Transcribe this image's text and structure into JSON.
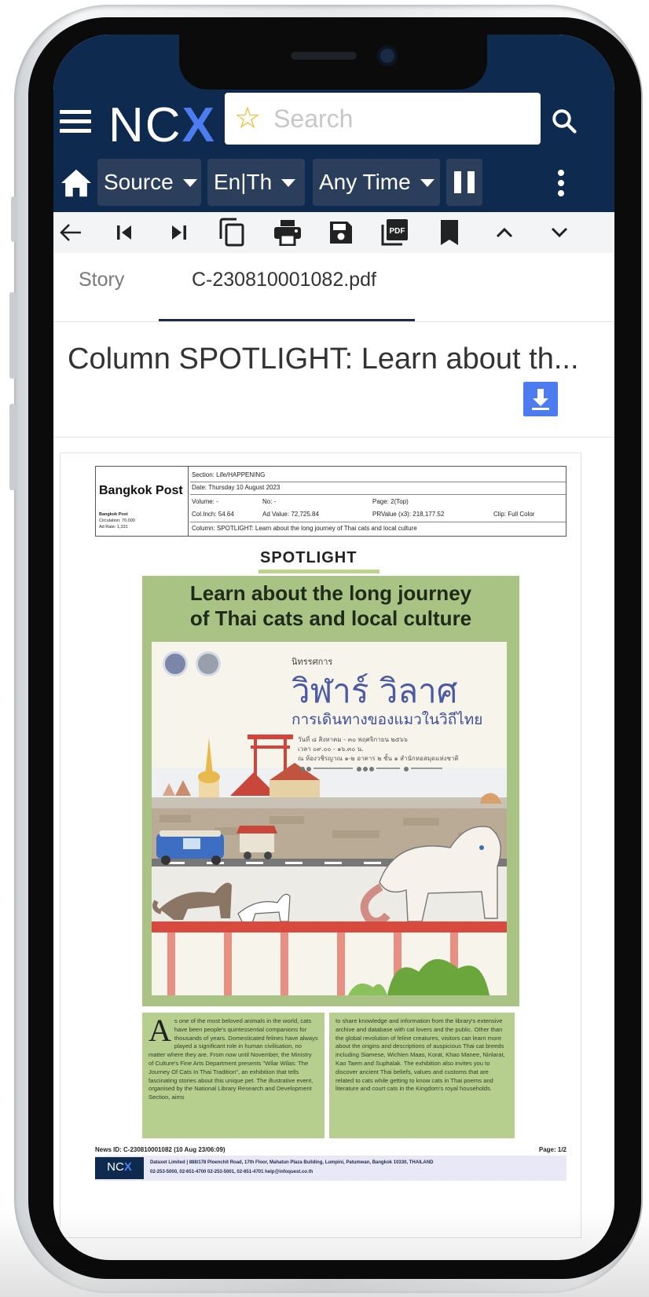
{
  "app": {
    "logo_prefix": "NC",
    "logo_accent": "X",
    "search_placeholder": "Search",
    "colors": {
      "header_bg": "#0f2a4f",
      "chip_bg": "#2b3f5c",
      "accent": "#4d7cf0",
      "star": "#f2b51c"
    }
  },
  "filters": {
    "source_label": "Source",
    "language_label": "En|Th",
    "time_label": "Any Time"
  },
  "toolbar": {
    "icons": [
      "back-arrow-icon",
      "first-page-icon",
      "last-page-icon",
      "copy-icon",
      "print-icon",
      "save-icon",
      "pdf-icon",
      "bookmark-icon",
      "chevron-up-icon",
      "chevron-down-icon"
    ],
    "pdf_badge": "PDF"
  },
  "tabs": {
    "story_label": "Story",
    "pdf_label": "C-230810001082.pdf"
  },
  "article": {
    "title": "Column SPOTLIGHT: Learn about th..."
  },
  "clipping": {
    "publication": "Bangkok Post",
    "pub_small": "Bangkok Post",
    "circulation": "Circulation: 70,000",
    "ad_rate": "Ad Rate: 1,331",
    "section": "Section: Life/HAPPENING",
    "date": "Date: Thursday 10 August 2023",
    "volume": "Volume: -",
    "no": "No: -",
    "page": "Page: 2(Top)",
    "col_inch": "Col.Inch: 54.64",
    "ad_value": "Ad Value: 72,725.84",
    "pr_value": "PRValue (x3): 218,177.52",
    "clip": "Clip: Full Color",
    "column": "Column: SPOTLIGHT: Learn about the long journey of Thai cats and local culture",
    "spotlight": "SPOTLIGHT",
    "headline_line1": "Learn about the long journey",
    "headline_line2": "of Thai cats and local culture",
    "poster_small": "นิทรรศการ",
    "poster_title": "วิฬาร์ วิลาศ",
    "poster_subtitle": "การเดินทางของแมวในวิถีไทย",
    "poster_line1": "วันที่ ๘ สิงหาคม - ๓๐ พฤศจิกายน ๒๕๖๖",
    "poster_line2": "เวลา ๐๙.๐๐ - ๑๖.๓๐ น.",
    "poster_line3": "ณ ห้องวชิรญาณ ๑-๒ อาคาร ๒ ชั้น ๑ สำนักหอสมุดแห่งชาติ",
    "dropcap": "A",
    "col1_text": "s one of the most beloved animals in the world, cats have been people's quintessential companions for thousands of years. Domesticated felines have always played a significant role in human civilisation, no matter where they are. From now until November, the Ministry of Culture's Fine Arts Department presents \"Wilar Wilas: The Journey Of Cats In Thai Tradition\", an exhibition that tells fascinating stories about this unique pet. The illustrative event, organised by the National Library Research and Development Section, aims",
    "col2_text": "to share knowledge and information from the library's extensive archive and database with cat lovers and the public. Other than the global revolution of feline creatures, visitors can learn more about the origins and descriptions of auspicious Thai cat breeds including Siamese, Wichien Maas, Korat, Khao Manee, Ninlarat, Kao Taem and Suphalak. The exhibition also invites you to discover ancient Thai beliefs, values and customs that are related to cats while getting to know cats in Thai poems and literature and court cats in the Kingdom's royal households.",
    "news_id": "News ID: C-230810001082 (10 Aug 23/06:09)",
    "page_of": "Page: 1/2",
    "footer_address": "Dataxet Limited | 888/178 Ploenchit Road, 17th Floor, Mahatun Plaza Building, Lumpini, Patumwan, Bangkok 10330, THAILAND",
    "footer_contacts": "02-253-5000, 02-651-4700     02-253-5001, 02-651-4701     help@infoquest.co.th"
  }
}
